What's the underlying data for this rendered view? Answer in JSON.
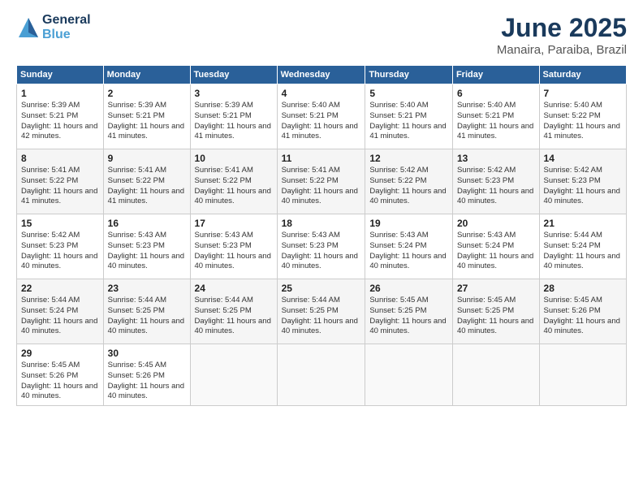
{
  "header": {
    "logo_line1": "General",
    "logo_line2": "Blue",
    "month": "June 2025",
    "location": "Manaira, Paraiba, Brazil"
  },
  "weekdays": [
    "Sunday",
    "Monday",
    "Tuesday",
    "Wednesday",
    "Thursday",
    "Friday",
    "Saturday"
  ],
  "weeks": [
    [
      {
        "day": "1",
        "sunrise": "5:39 AM",
        "sunset": "5:21 PM",
        "daylight": "11 hours and 42 minutes."
      },
      {
        "day": "2",
        "sunrise": "5:39 AM",
        "sunset": "5:21 PM",
        "daylight": "11 hours and 41 minutes."
      },
      {
        "day": "3",
        "sunrise": "5:39 AM",
        "sunset": "5:21 PM",
        "daylight": "11 hours and 41 minutes."
      },
      {
        "day": "4",
        "sunrise": "5:40 AM",
        "sunset": "5:21 PM",
        "daylight": "11 hours and 41 minutes."
      },
      {
        "day": "5",
        "sunrise": "5:40 AM",
        "sunset": "5:21 PM",
        "daylight": "11 hours and 41 minutes."
      },
      {
        "day": "6",
        "sunrise": "5:40 AM",
        "sunset": "5:21 PM",
        "daylight": "11 hours and 41 minutes."
      },
      {
        "day": "7",
        "sunrise": "5:40 AM",
        "sunset": "5:22 PM",
        "daylight": "11 hours and 41 minutes."
      }
    ],
    [
      {
        "day": "8",
        "sunrise": "5:41 AM",
        "sunset": "5:22 PM",
        "daylight": "11 hours and 41 minutes."
      },
      {
        "day": "9",
        "sunrise": "5:41 AM",
        "sunset": "5:22 PM",
        "daylight": "11 hours and 41 minutes."
      },
      {
        "day": "10",
        "sunrise": "5:41 AM",
        "sunset": "5:22 PM",
        "daylight": "11 hours and 40 minutes."
      },
      {
        "day": "11",
        "sunrise": "5:41 AM",
        "sunset": "5:22 PM",
        "daylight": "11 hours and 40 minutes."
      },
      {
        "day": "12",
        "sunrise": "5:42 AM",
        "sunset": "5:22 PM",
        "daylight": "11 hours and 40 minutes."
      },
      {
        "day": "13",
        "sunrise": "5:42 AM",
        "sunset": "5:23 PM",
        "daylight": "11 hours and 40 minutes."
      },
      {
        "day": "14",
        "sunrise": "5:42 AM",
        "sunset": "5:23 PM",
        "daylight": "11 hours and 40 minutes."
      }
    ],
    [
      {
        "day": "15",
        "sunrise": "5:42 AM",
        "sunset": "5:23 PM",
        "daylight": "11 hours and 40 minutes."
      },
      {
        "day": "16",
        "sunrise": "5:43 AM",
        "sunset": "5:23 PM",
        "daylight": "11 hours and 40 minutes."
      },
      {
        "day": "17",
        "sunrise": "5:43 AM",
        "sunset": "5:23 PM",
        "daylight": "11 hours and 40 minutes."
      },
      {
        "day": "18",
        "sunrise": "5:43 AM",
        "sunset": "5:23 PM",
        "daylight": "11 hours and 40 minutes."
      },
      {
        "day": "19",
        "sunrise": "5:43 AM",
        "sunset": "5:24 PM",
        "daylight": "11 hours and 40 minutes."
      },
      {
        "day": "20",
        "sunrise": "5:43 AM",
        "sunset": "5:24 PM",
        "daylight": "11 hours and 40 minutes."
      },
      {
        "day": "21",
        "sunrise": "5:44 AM",
        "sunset": "5:24 PM",
        "daylight": "11 hours and 40 minutes."
      }
    ],
    [
      {
        "day": "22",
        "sunrise": "5:44 AM",
        "sunset": "5:24 PM",
        "daylight": "11 hours and 40 minutes."
      },
      {
        "day": "23",
        "sunrise": "5:44 AM",
        "sunset": "5:25 PM",
        "daylight": "11 hours and 40 minutes."
      },
      {
        "day": "24",
        "sunrise": "5:44 AM",
        "sunset": "5:25 PM",
        "daylight": "11 hours and 40 minutes."
      },
      {
        "day": "25",
        "sunrise": "5:44 AM",
        "sunset": "5:25 PM",
        "daylight": "11 hours and 40 minutes."
      },
      {
        "day": "26",
        "sunrise": "5:45 AM",
        "sunset": "5:25 PM",
        "daylight": "11 hours and 40 minutes."
      },
      {
        "day": "27",
        "sunrise": "5:45 AM",
        "sunset": "5:25 PM",
        "daylight": "11 hours and 40 minutes."
      },
      {
        "day": "28",
        "sunrise": "5:45 AM",
        "sunset": "5:26 PM",
        "daylight": "11 hours and 40 minutes."
      }
    ],
    [
      {
        "day": "29",
        "sunrise": "5:45 AM",
        "sunset": "5:26 PM",
        "daylight": "11 hours and 40 minutes."
      },
      {
        "day": "30",
        "sunrise": "5:45 AM",
        "sunset": "5:26 PM",
        "daylight": "11 hours and 40 minutes."
      },
      null,
      null,
      null,
      null,
      null
    ]
  ]
}
